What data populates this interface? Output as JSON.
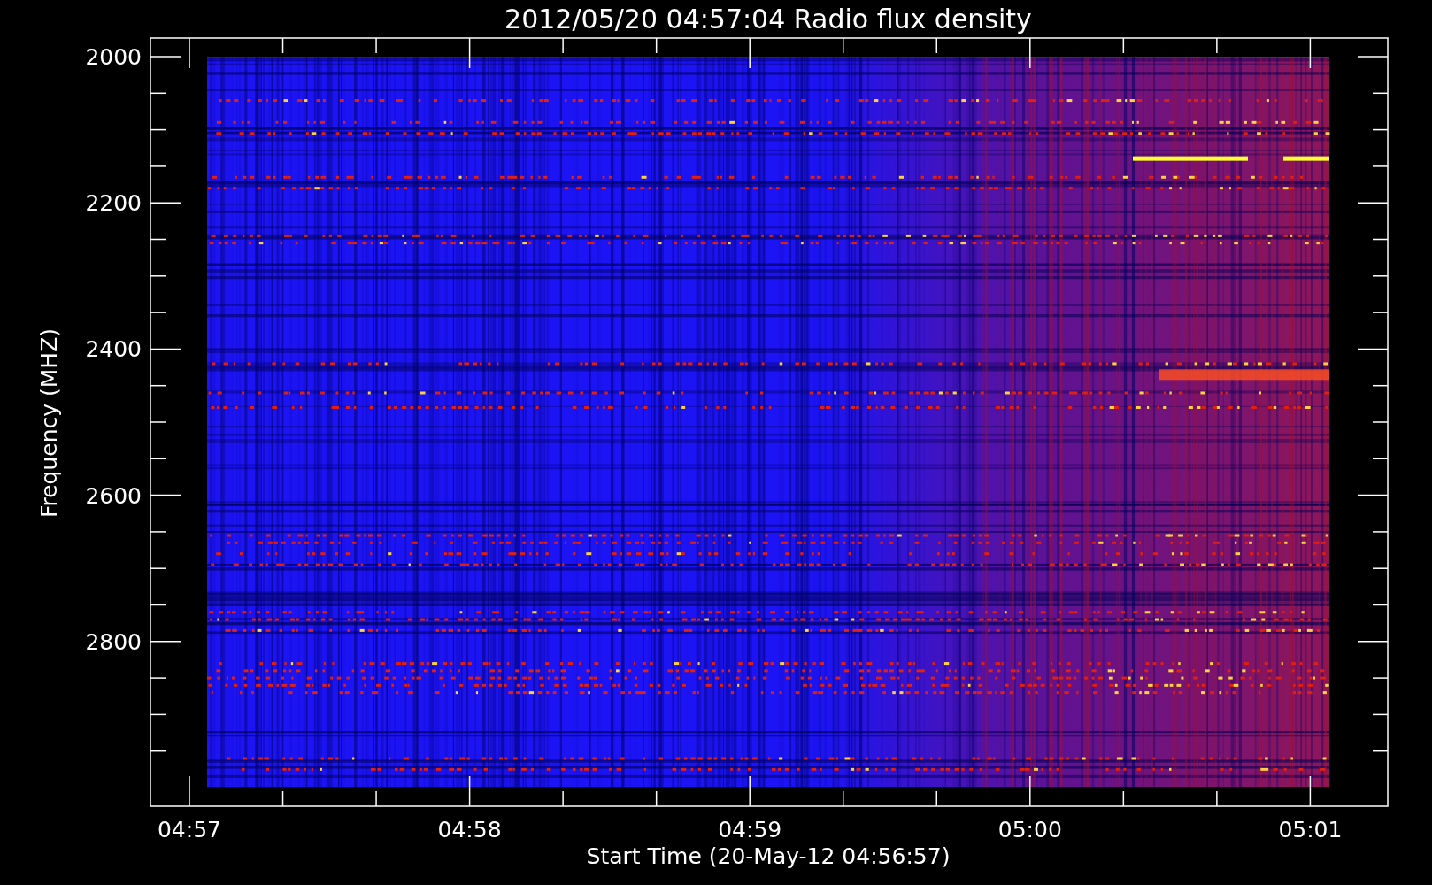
{
  "title": "2012/05/20 04:57:04 Radio flux density",
  "y_axis": {
    "label": "Frequency (MHZ)",
    "ticks": [
      "2000",
      "2200",
      "2400",
      "2600",
      "2800"
    ]
  },
  "x_axis": {
    "label": "Start Time (20-May-12 04:56:57)",
    "ticks": [
      "04:57",
      "04:58",
      "04:59",
      "05:00",
      "05:01"
    ]
  }
}
